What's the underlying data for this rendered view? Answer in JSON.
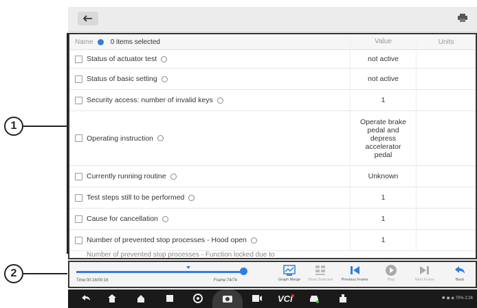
{
  "callouts": [
    "1",
    "2"
  ],
  "header": {
    "back_icon": "back-arrow-icon",
    "print_icon": "print-icon"
  },
  "table": {
    "columns": {
      "name": "Name",
      "selected": "0 items selected",
      "value": "Value",
      "units": "Units"
    },
    "rows": [
      {
        "name": "Status of actuator test",
        "value": "not active",
        "units": ""
      },
      {
        "name": "Status of basic setting",
        "value": "not active",
        "units": ""
      },
      {
        "name": "Security access: number of invalid keys",
        "value": "1",
        "units": ""
      },
      {
        "name": "Operating instruction",
        "value": "Operate brake pedal and depress accelerator pedal",
        "units": ""
      },
      {
        "name": "Currently running routine",
        "value": "Unknown",
        "units": ""
      },
      {
        "name": "Test steps still to be performed",
        "value": "1",
        "units": ""
      },
      {
        "name": "Cause for cancellation",
        "value": "1",
        "units": ""
      },
      {
        "name": "Number of prevented stop processes - Hood open",
        "value": "1",
        "units": ""
      }
    ],
    "partial_row": "Number of prevented stop processes - Function locked due to"
  },
  "toolbar": {
    "time": "Time:00:16/00:16",
    "frame": "Frame:74/74",
    "progress_fraction": 1.0,
    "buttons": [
      {
        "label": "Graph Merge",
        "icon": "graph-merge-icon",
        "enabled": true
      },
      {
        "label": "Show Selected",
        "icon": "show-selected-icon",
        "enabled": false
      },
      {
        "label": "Previous Frame",
        "icon": "previous-frame-icon",
        "enabled": true
      },
      {
        "label": "Play",
        "icon": "play-icon",
        "enabled": false
      },
      {
        "label": "Next Frame",
        "icon": "next-frame-icon",
        "enabled": false
      },
      {
        "label": "Back",
        "icon": "back-icon",
        "enabled": true
      }
    ]
  },
  "navbar": {
    "icons": [
      "back-icon",
      "home-icon",
      "autel-home-icon",
      "recent-apps-icon",
      "browser-icon",
      "camera-icon",
      "screen-record-icon",
      "vci-icon",
      "car-icon",
      "tools-icon"
    ],
    "status": "✱ ◉ ◈ 70% 2:26"
  },
  "colors": {
    "accent": "#2f7de1",
    "navbar": "#1a1a1a"
  }
}
